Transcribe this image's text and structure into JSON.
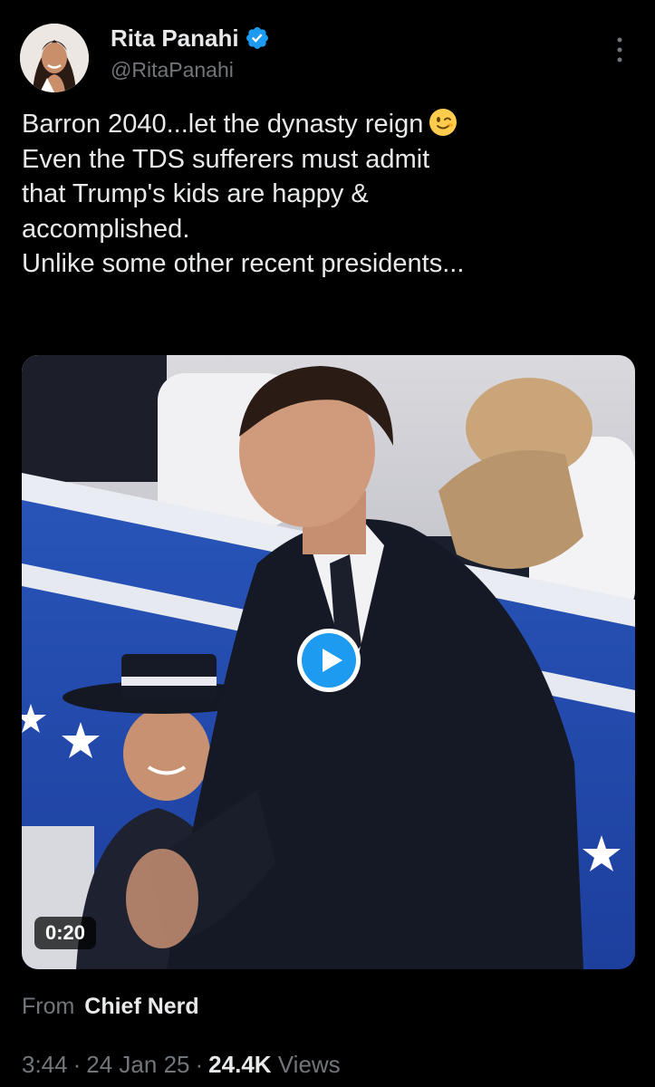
{
  "author": {
    "display_name": "Rita Panahi",
    "handle": "@RitaPanahi",
    "verified": true,
    "avatar_icon": "profile-photo",
    "verified_icon": "verified-badge-icon",
    "verified_color": "#1d9bf0"
  },
  "tweet": {
    "lines": [
      "Barron 2040...let the dynasty reign",
      "Even the TDS sufferers must admit",
      "that Trump's kids are happy &",
      "accomplished.",
      "Unlike some other recent presidents..."
    ],
    "emoji": "wink-face-icon"
  },
  "media": {
    "type": "video",
    "duration": "0:20",
    "play_icon": "play-icon",
    "accent_color": "#1d9bf0"
  },
  "source": {
    "prefix": "From",
    "name": "Chief Nerd"
  },
  "meta": {
    "time": "3:44",
    "date": "24 Jan 25",
    "views_count": "24.4K",
    "views_label": "Views"
  },
  "colors": {
    "background": "#000000",
    "text_primary": "#e7e9ea",
    "text_secondary": "#71767b"
  }
}
